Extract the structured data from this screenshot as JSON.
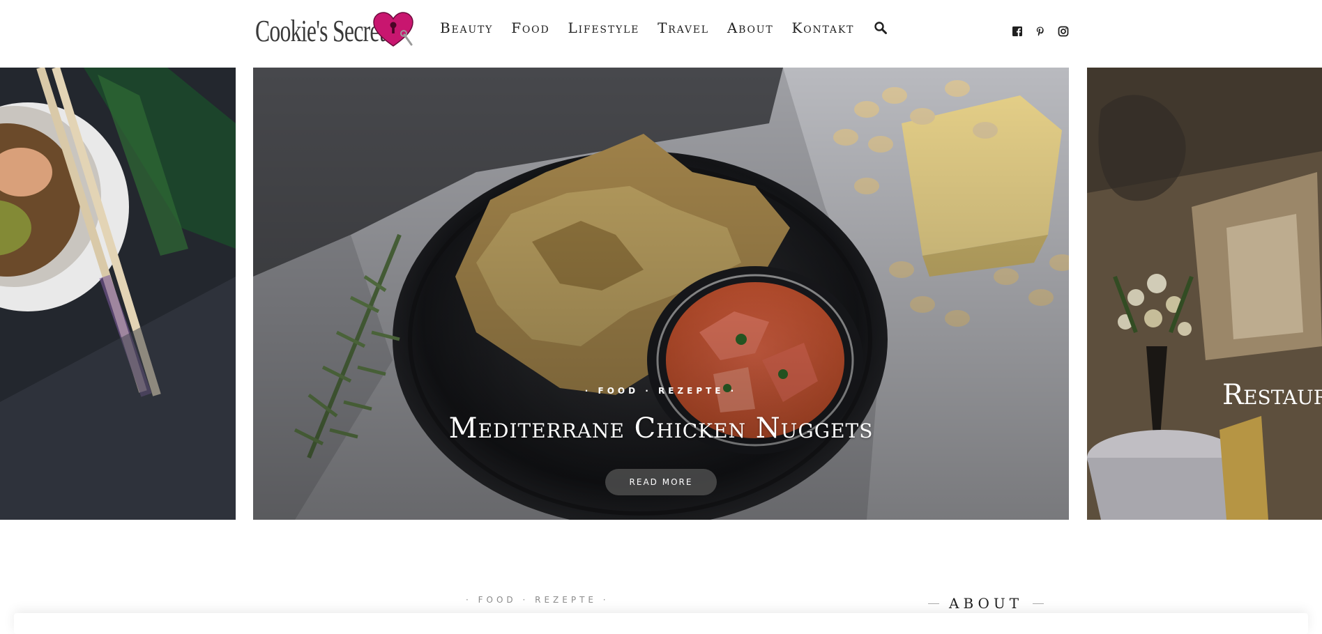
{
  "logo": {
    "text": "Cookie's Secrets",
    "heart_color": "#c8166f"
  },
  "nav": {
    "items": [
      "Beauty",
      "Food",
      "Lifestyle",
      "Travel",
      "About",
      "Kontakt"
    ],
    "search_icon": "search-icon"
  },
  "social": {
    "icons": [
      "facebook-icon",
      "pinterest-icon",
      "instagram-icon"
    ]
  },
  "slider": {
    "main": {
      "categories": "· FOOD · REZEPTE ·",
      "title": "Mediterrane Chicken Nuggets",
      "button": "Read More"
    },
    "right": {
      "title_partial": "Restaur"
    }
  },
  "post": {
    "categories": "· FOOD · REZEPTE ·",
    "title_partial": ""
  },
  "sidebar": {
    "about_heading": "ABOUT"
  },
  "colors": {
    "brand_pink": "#c8166f",
    "text_dark": "#1f1f1f",
    "button_bg": "#4b4b4b"
  }
}
